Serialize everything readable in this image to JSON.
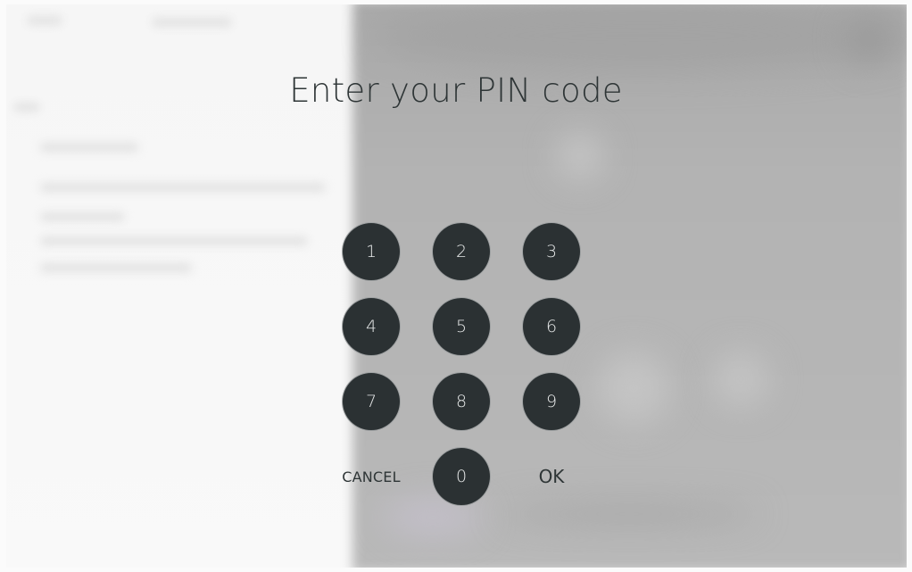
{
  "title": "Enter your PIN code",
  "keypad": {
    "digits": [
      "1",
      "2",
      "3",
      "4",
      "5",
      "6",
      "7",
      "8",
      "9",
      "0"
    ],
    "cancel_label": "CANCEL",
    "ok_label": "OK"
  },
  "colors": {
    "key_fill": "#2b3133",
    "key_text": "#e6e8e8",
    "title_text": "#2e3536",
    "left_background": "#f7f7f7",
    "right_background": "#b3b3b3"
  }
}
